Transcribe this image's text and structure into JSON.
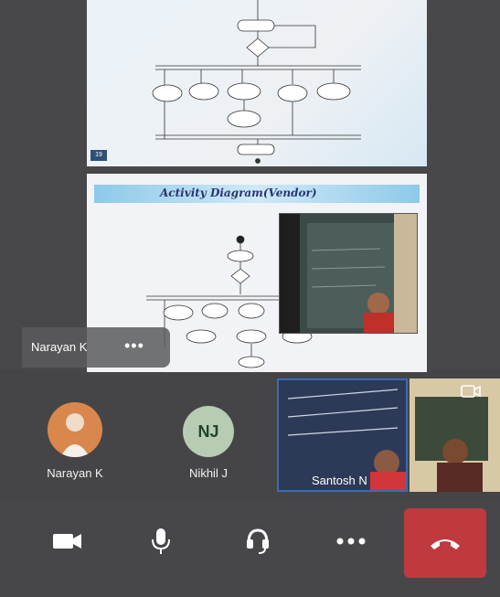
{
  "shared_screen": {
    "slide1_number": "19",
    "slide2_title": "Activity Diagram(Vendor)"
  },
  "spotlight_tag": {
    "name": "Narayan K",
    "more": "•••"
  },
  "participants": [
    {
      "name": "Narayan K",
      "initials": ""
    },
    {
      "name": "Nikhil J",
      "initials": "NJ"
    }
  ],
  "video_tiles": [
    {
      "name": "Santosh N"
    }
  ],
  "controls": {
    "icons": [
      "video-camera-icon",
      "microphone-icon",
      "headset-icon",
      "more-icon",
      "hang-up-icon"
    ]
  },
  "colors": {
    "end_call": "#c0393f",
    "active_border": "#3a6bb5",
    "avatar_nj_bg": "#b8ccb4"
  }
}
